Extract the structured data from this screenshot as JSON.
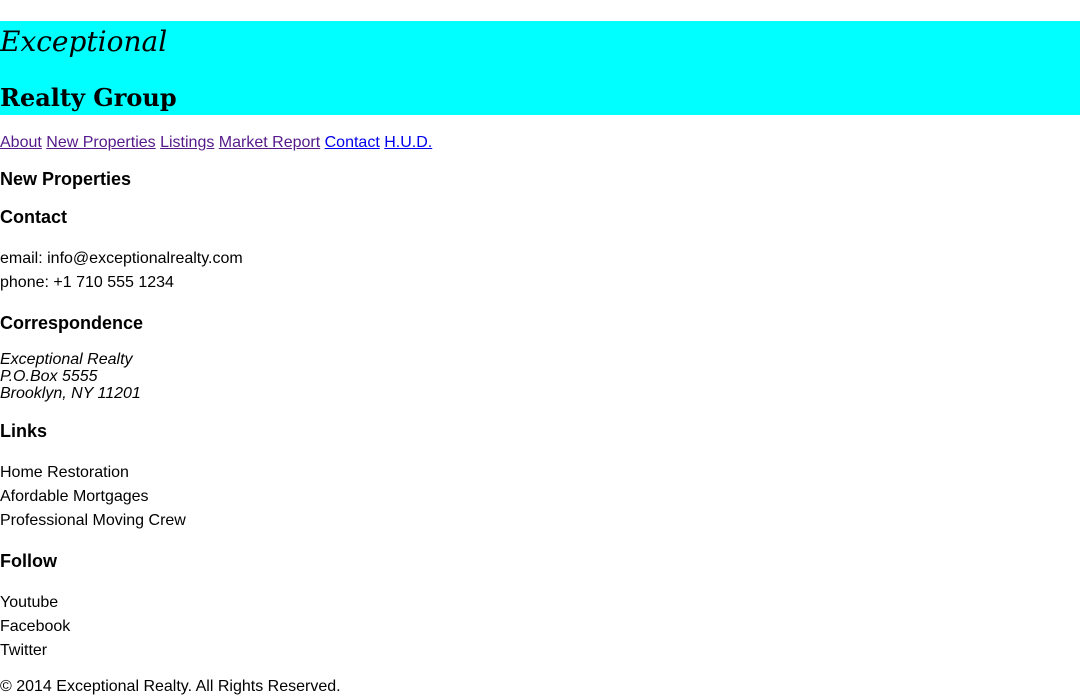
{
  "header": {
    "brand_line1": "Exceptional",
    "brand_line2": "Realty Group",
    "bg_color": "#00ffff"
  },
  "nav": {
    "items": [
      {
        "label": "About",
        "state": "visited"
      },
      {
        "label": "New Properties",
        "state": "visited"
      },
      {
        "label": "Listings",
        "state": "visited"
      },
      {
        "label": "Market Report",
        "state": "visited"
      },
      {
        "label": "Contact",
        "state": "unvisited"
      },
      {
        "label": "H.U.D.",
        "state": "unvisited"
      }
    ],
    "visited_color": "#551a8b",
    "unvisited_color": "#0000ee"
  },
  "sections": {
    "new_properties": {
      "title": "New Properties"
    },
    "contact": {
      "title": "Contact",
      "email": "email: info@exceptionalrealty.com",
      "phone": "phone: +1 710 555 1234"
    },
    "correspondence": {
      "title": "Correspondence",
      "address": [
        "Exceptional Realty",
        "P.O.Box 5555",
        "Brooklyn, NY 11201"
      ]
    },
    "links": {
      "title": "Links",
      "items": [
        "Home Restoration",
        "Afordable Mortgages",
        "Professional Moving Crew"
      ]
    },
    "follow": {
      "title": "Follow",
      "items": [
        "Youtube",
        "Facebook",
        "Twitter"
      ]
    }
  },
  "footer": {
    "copyright": "© 2014 Exceptional Realty. All Rights Reserved."
  }
}
